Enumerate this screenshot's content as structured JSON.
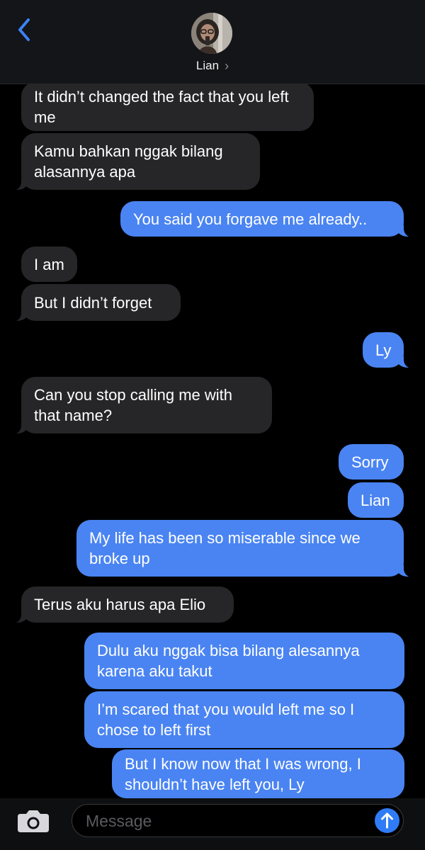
{
  "header": {
    "contact_name": "Lian",
    "chevron": "›"
  },
  "messages": [
    {
      "side": "left",
      "text": "It didn’t changed the fact that you left me"
    },
    {
      "side": "left",
      "text": "Kamu bahkan nggak bilang alasannya apa"
    },
    {
      "side": "right",
      "text": "You said you forgave me already.."
    },
    {
      "side": "left",
      "text": "I am"
    },
    {
      "side": "left",
      "text": "But I didn’t forget"
    },
    {
      "side": "right",
      "text": "Ly"
    },
    {
      "side": "left",
      "text": "Can you stop calling me with that name?"
    },
    {
      "side": "right",
      "text": "Sorry"
    },
    {
      "side": "right",
      "text": "Lian"
    },
    {
      "side": "right",
      "text": "My life has been so miserable since we broke up"
    },
    {
      "side": "left",
      "text": "Terus aku harus apa Elio"
    },
    {
      "side": "right",
      "text": "Dulu aku nggak bisa bilang alesannya karena aku takut"
    },
    {
      "side": "right",
      "text": "I’m scared that you would left me so I chose to left first"
    },
    {
      "side": "right",
      "text": "But I know now that I was wrong, I shouldn’t have left you, Ly"
    }
  ],
  "composer": {
    "placeholder": "Message"
  },
  "colors": {
    "incoming": "#262628",
    "outgoing": "#4a84f2",
    "accent": "#2f7cf6"
  },
  "icons": {
    "back": "back-chevron-icon",
    "camera": "camera-icon",
    "send": "send-arrow-icon"
  }
}
